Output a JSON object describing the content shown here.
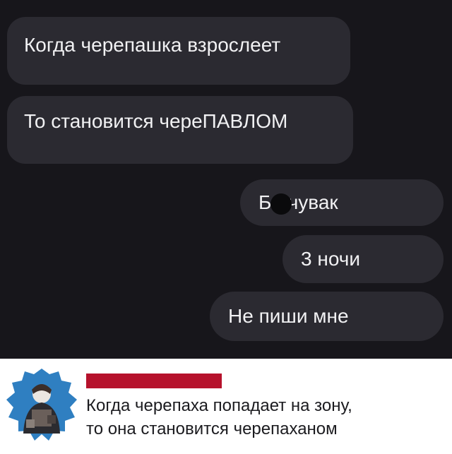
{
  "messages": [
    {
      "text": "Когда черепашка взрослеет",
      "side": "incoming"
    },
    {
      "text": "То становится череПАВЛОМ",
      "side": "incoming"
    },
    {
      "text": "Б  , чувак",
      "side": "outgoing"
    },
    {
      "text": "3 ночи",
      "side": "outgoing"
    },
    {
      "text": "Не пиши мне",
      "side": "outgoing"
    }
  ],
  "comment": {
    "lines": [
      "Когда черепаха попадает на зону,",
      "то она становится черепаханом"
    ]
  },
  "colors": {
    "chat_background": "#17161b",
    "bubble": "#2b2a31",
    "bubble_text": "#f1f1f3",
    "username_redaction": "#b6122c"
  }
}
